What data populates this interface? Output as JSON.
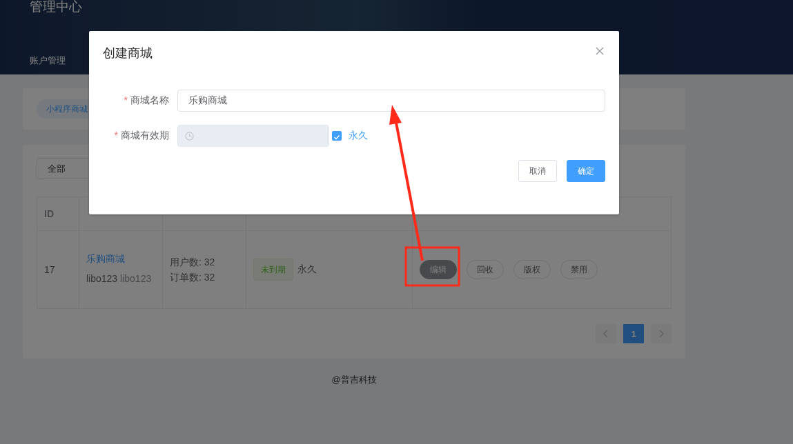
{
  "header": {
    "title": "管理中心",
    "nav": [
      "账户管理"
    ]
  },
  "tabs": [
    {
      "label": "小程序商城",
      "selected": true
    }
  ],
  "filter": {
    "value": "全部"
  },
  "table": {
    "columns": [
      "ID"
    ],
    "rows": [
      {
        "id": "17",
        "name": "乐购商城",
        "account": "libo123",
        "account_alias": "libo123",
        "stats": [
          "用户数: 32",
          "订单数: 32"
        ],
        "status": "未到期",
        "validity": "永久",
        "actions": [
          {
            "label": "编辑",
            "selected": true
          },
          {
            "label": "回收",
            "selected": false
          },
          {
            "label": "版权",
            "selected": false
          },
          {
            "label": "禁用",
            "selected": false
          }
        ]
      }
    ]
  },
  "pagination": {
    "pages": [
      {
        "label": "1",
        "selected": true
      }
    ]
  },
  "footer": "@普吉科技",
  "dialog": {
    "title": "创建商城",
    "fields": [
      {
        "kind": "text",
        "label": "商城名称",
        "required_mark": "*",
        "value": "乐购商城"
      },
      {
        "kind": "date",
        "label": "商城有效期",
        "required_mark": "*",
        "disabled": true,
        "checkbox": {
          "label": "永久",
          "checked": true
        }
      }
    ],
    "buttons": [
      {
        "label": "取消",
        "primary": false
      },
      {
        "label": "确定",
        "primary": true
      }
    ]
  }
}
